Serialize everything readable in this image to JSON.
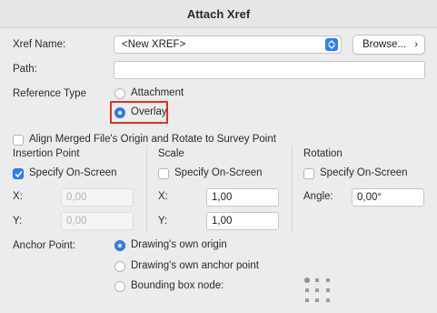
{
  "window": {
    "title": "Attach Xref"
  },
  "xref_name": {
    "label": "Xref Name:",
    "selected": "<New XREF>",
    "browse_label": "Browse..."
  },
  "path": {
    "label": "Path:",
    "value": ""
  },
  "reference_type": {
    "label": "Reference Type",
    "options": [
      {
        "label": "Attachment",
        "selected": false
      },
      {
        "label": "Overlay",
        "selected": true
      }
    ]
  },
  "align_checkbox": {
    "label": "Align Merged File's Origin and Rotate to Survey Point",
    "checked": false
  },
  "insertion_point": {
    "title": "Insertion Point",
    "specify_label": "Specify On-Screen",
    "specify_checked": true,
    "x_label": "X:",
    "x_value": "0,00",
    "y_label": "Y:",
    "y_value": "0,00"
  },
  "scale": {
    "title": "Scale",
    "specify_label": "Specify On-Screen",
    "specify_checked": false,
    "x_label": "X:",
    "x_value": "1,00",
    "y_label": "Y:",
    "y_value": "1,00"
  },
  "rotation": {
    "title": "Rotation",
    "specify_label": "Specify On-Screen",
    "specify_checked": false,
    "angle_label": "Angle:",
    "angle_value": "0,00°"
  },
  "anchor_point": {
    "label": "Anchor Point:",
    "options": [
      {
        "label": "Drawing's own origin",
        "selected": true
      },
      {
        "label": "Drawing's own anchor point",
        "selected": false
      },
      {
        "label": "Bounding box node:",
        "selected": false
      }
    ]
  },
  "colors": {
    "accent": "#2f7ef5",
    "highlight": "#e0302a"
  }
}
